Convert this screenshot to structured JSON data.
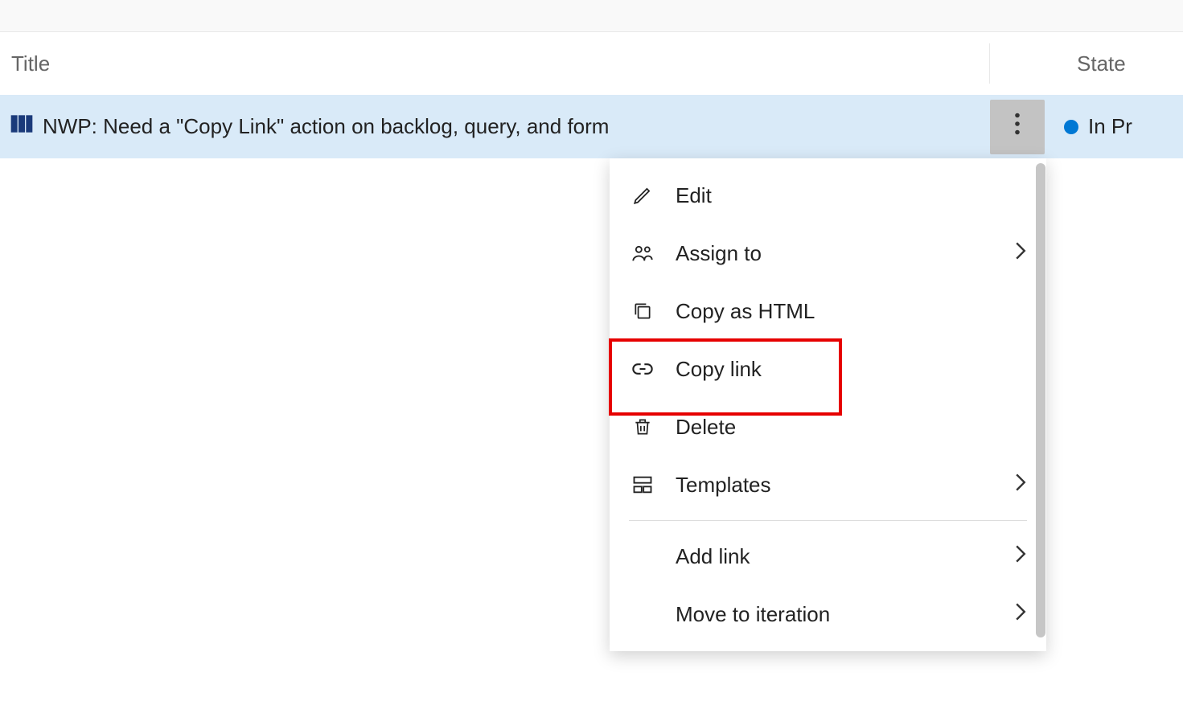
{
  "columns": {
    "title": "Title",
    "state": "State"
  },
  "row": {
    "title": "NWP: Need a \"Copy Link\" action on backlog, query, and form",
    "state": "In Pr"
  },
  "menu": {
    "edit": "Edit",
    "assign_to": "Assign to",
    "copy_html": "Copy as HTML",
    "copy_link": "Copy link",
    "delete": "Delete",
    "templates": "Templates",
    "add_link": "Add link",
    "move_iteration": "Move to iteration"
  }
}
